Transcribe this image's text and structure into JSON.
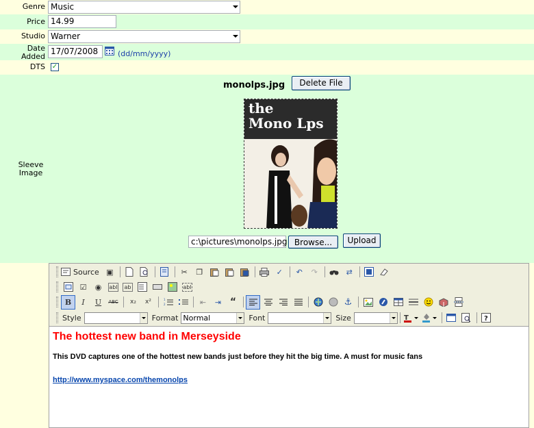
{
  "form": {
    "genre": {
      "label": "Genre",
      "value": "Music"
    },
    "price": {
      "label": "Price",
      "value": "14.99"
    },
    "studio": {
      "label": "Studio",
      "value": "Warner"
    },
    "date_added": {
      "label_line1": "Date",
      "label_line2": "Added",
      "value": "17/07/2008",
      "hint": "(dd/mm/yyyy)"
    },
    "dts": {
      "label": "DTS",
      "checked": true,
      "check_glyph": "✓"
    },
    "sleeve": {
      "label_line1": "Sleeve",
      "label_line2": "Image",
      "filename": "monolps.jpg",
      "delete_label": "Delete File",
      "image_text_line1": "the",
      "image_text_line2": "Mono Lps",
      "upload_path": "c:\\pictures\\monolps.jpg",
      "browse_label": "Browse...",
      "upload_label": "Upload"
    }
  },
  "editor": {
    "source_label": "Source",
    "style_label": "Style",
    "style_value": "",
    "format_label": "Format",
    "format_value": "Normal",
    "font_label": "Font",
    "font_value": "",
    "size_label": "Size",
    "size_value": "",
    "bold": "B",
    "italic": "I",
    "underline": "U",
    "strike": "ABC",
    "subscript": "x₂",
    "superscript": "x²",
    "title": "The hottest new band in Merseyside",
    "paragraph": "This DVD captures one of the hottest new bands just before they hit the big time.  A must for music fans",
    "link": "http://www.myspace.com/themonolps"
  },
  "colors": {
    "yellow_row": "#ffffe0",
    "green_row": "#dbffdb",
    "title_red": "#ff0000",
    "link_blue": "#0645ad"
  }
}
